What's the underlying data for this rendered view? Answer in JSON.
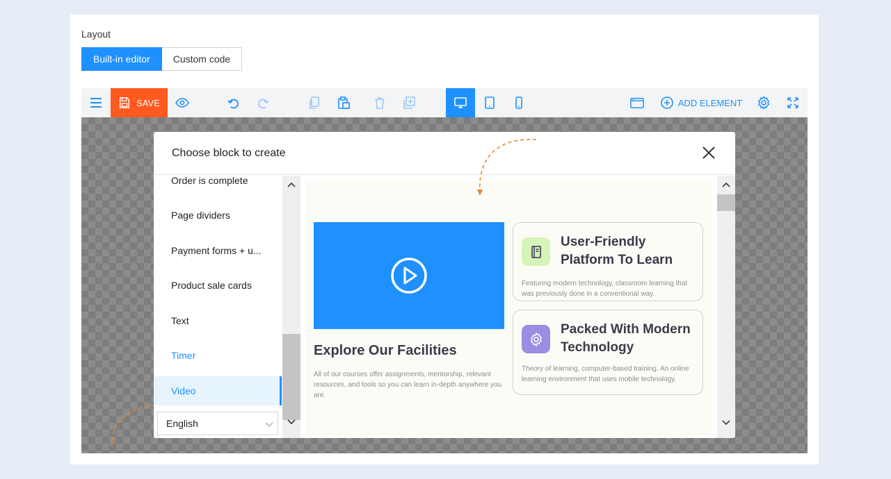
{
  "layout": {
    "label": "Layout",
    "modes": [
      "Built-in editor",
      "Custom code"
    ]
  },
  "toolbar": {
    "save_label": "SAVE",
    "add_element_label": "ADD ELEMENT",
    "icons": [
      "menu-icon",
      "save-icon",
      "eye-icon",
      "undo-icon",
      "redo-icon",
      "copy-icon",
      "paste-icon",
      "trash-icon",
      "duplicate-icon",
      "desktop-icon",
      "tablet-icon",
      "mobile-icon",
      "window-icon",
      "plus-circle-icon",
      "gear-icon",
      "fullscreen-icon"
    ]
  },
  "modal": {
    "title": "Choose block to create",
    "categories": [
      {
        "label": "Order is complete"
      },
      {
        "label": "Page dividers"
      },
      {
        "label": "Payment forms + u..."
      },
      {
        "label": "Product sale cards"
      },
      {
        "label": "Text"
      },
      {
        "label": "Timer"
      },
      {
        "label": "Video"
      }
    ],
    "selected_category": "Video",
    "language": "English"
  },
  "preview": {
    "facility_title": "Explore Our Facilities",
    "facility_desc": "All of our courses offer assignments, mentorship, relevant resources, and tools so you can learn in-depth anywhere you are.",
    "cards": [
      {
        "title": "User-Friendly Platform To Learn",
        "desc": "Featuring modern technology, classroom learning that was previously done in a conventional way.",
        "icon": "notebook-icon",
        "icon_color": "#d6f3b8"
      },
      {
        "title": "Packed With Modern Technology",
        "desc": "Theory of learning, computer-based training. An online learning environment that uses mobile technology.",
        "icon": "gear-cog-icon",
        "icon_color": "#9b8de3"
      }
    ]
  },
  "colors": {
    "accent": "#1e90ff",
    "save": "#ff5a1f",
    "dashed_arrow": "#e8872a"
  }
}
